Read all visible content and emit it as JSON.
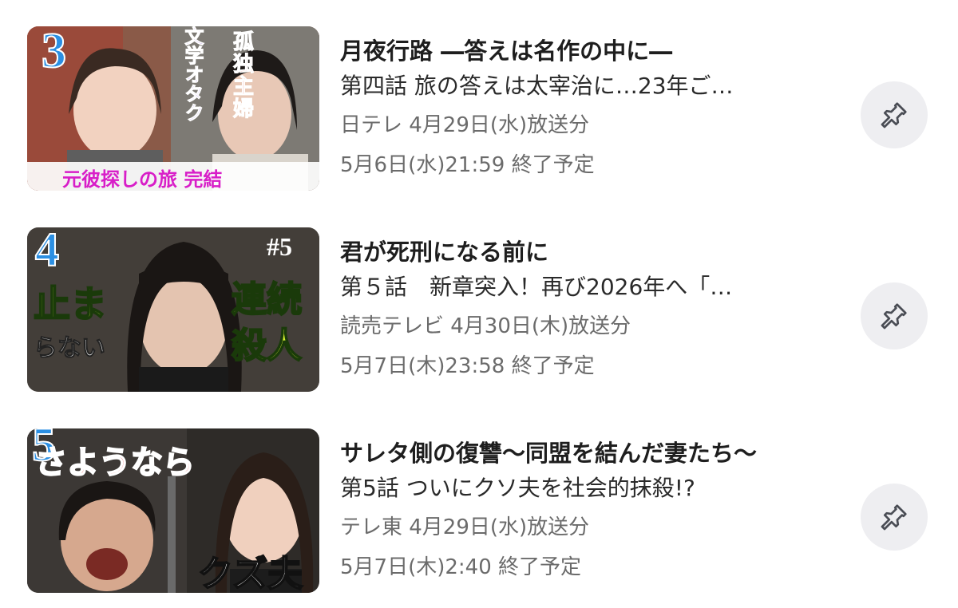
{
  "items": [
    {
      "rank": "3",
      "thumb_texts": [
        "孤独主婦",
        "文学オタク",
        "元彼探しの旅 完結"
      ],
      "title": "月夜行路 ―答えは名作の中に―",
      "subtitle": "第四話 旅の答えは太宰治に…23年ご…",
      "broadcast": "日テレ 4月29日(水)放送分",
      "end": "5月6日(水)21:59 終了予定"
    },
    {
      "rank": "4",
      "thumb_texts": [
        "止ま",
        "らない",
        "#5",
        "連続",
        "殺人"
      ],
      "title": "君が死刑になる前に",
      "subtitle": "第５話　新章突入！再び2026年へ「…",
      "broadcast": "読売テレビ 4月30日(木)放送分",
      "end": "5月7日(木)23:58 終了予定"
    },
    {
      "rank": "5",
      "thumb_texts": [
        "さようなら",
        "クズ夫"
      ],
      "title": "サレタ側の復讐～同盟を結んだ妻たち～",
      "subtitle": "第5話 ついにクソ夫を社会的抹殺!?",
      "broadcast": "テレ東 4月29日(水)放送分",
      "end": "5月7日(木)2:40 終了予定"
    }
  ],
  "icons": {
    "pin": "pushpin-icon"
  },
  "colors": {
    "rank": "#2b8fe3",
    "pin_bg": "#eeeef1",
    "meta": "#6b6b6b"
  }
}
